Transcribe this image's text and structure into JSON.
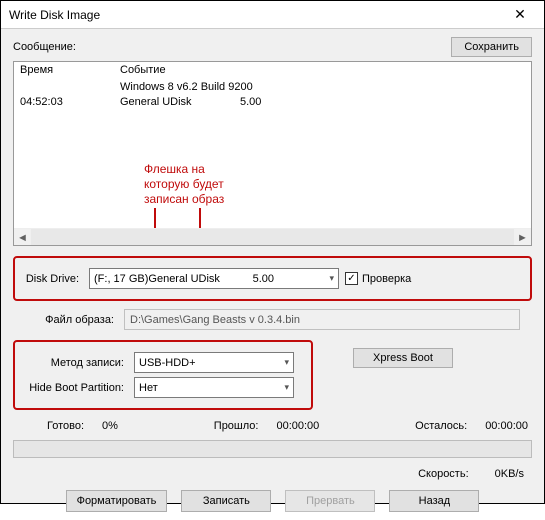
{
  "window": {
    "title": "Write Disk Image",
    "close_icon": "✕"
  },
  "topbar": {
    "message_label": "Сообщение:",
    "save_button": "Сохранить"
  },
  "log": {
    "col_time": "Время",
    "col_event": "Событие",
    "rows": [
      {
        "time": "",
        "event": "Windows 8 v6.2 Build 9200"
      },
      {
        "time": "04:52:03",
        "event_name": "General UDisk",
        "event_val": "5.00"
      }
    ],
    "annotation": "Флешка на\nкоторую будет\nзаписан образ",
    "scroll_left": "◄",
    "scroll_right": "►"
  },
  "fields": {
    "disk_drive_label": "Disk Drive:",
    "disk_drive_name": "(F:, 17 GB)General UDisk",
    "disk_drive_val": "5.00",
    "verify_label": "Проверка",
    "verify_check": "✓",
    "image_file_label": "Файл образа:",
    "image_file_value": "D:\\Games\\Gang Beasts v 0.3.4.bin",
    "write_method_label": "Метод записи:",
    "write_method_value": "USB-HDD+",
    "hide_boot_label": "Hide Boot Partition:",
    "hide_boot_value": "Нет",
    "xpress_boot": "Xpress Boot"
  },
  "status": {
    "done_label": "Готово:",
    "done_value": "0%",
    "elapsed_label": "Прошло:",
    "elapsed_value": "00:00:00",
    "remain_label": "Осталось:",
    "remain_value": "00:00:00",
    "speed_label": "Скорость:",
    "speed_value": "0KB/s"
  },
  "buttons": {
    "format": "Форматировать",
    "write": "Записать",
    "abort": "Прервать",
    "back": "Назад"
  }
}
